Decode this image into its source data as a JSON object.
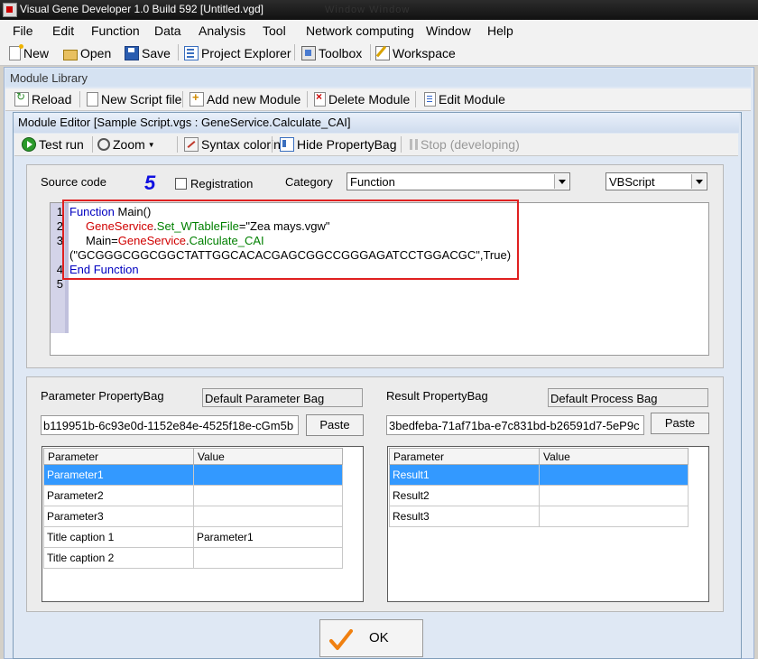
{
  "window": {
    "title": "Visual Gene Developer 1.0 Build 592    [Untitled.vgd]",
    "ghost_text": "Window     Window"
  },
  "menu": [
    "File",
    "Edit",
    "Function",
    "Data",
    "Analysis",
    "Tool",
    "Network computing",
    "Window",
    "Help"
  ],
  "toolbar": {
    "new": "New",
    "open": "Open",
    "save": "Save",
    "project_explorer": "Project Explorer",
    "toolbox": "Toolbox",
    "workspace": "Workspace"
  },
  "module_library": {
    "title": "Module Library",
    "toolbar": {
      "reload": "Reload",
      "new_script": "New Script file",
      "add_module": "Add new Module",
      "delete_module": "Delete Module",
      "edit_module": "Edit Module"
    }
  },
  "module_editor": {
    "title": "Module Editor    [Sample Script.vgs : GeneService.Calculate_CAI]",
    "toolbar": {
      "test_run": "Test run",
      "zoom": "Zoom",
      "syntax": "Syntax coloring",
      "hide_bag": "Hide PropertyBag",
      "stop": "Stop (developing)"
    },
    "source_code_label": "Source code",
    "step_number": "5",
    "registration_label": "Registration",
    "registration_checked": false,
    "category_label": "Category",
    "category_value": "Function",
    "language_value": "VBScript",
    "line_numbers": [
      "1",
      "2",
      "3",
      "4",
      "5"
    ],
    "code": {
      "l1_kw": "Function",
      "l1_rest": " Main()",
      "l2_obj": "GeneService",
      "l2_dot": ".",
      "l2_meth": "Set_WTableFile",
      "l2_rest": "=\"Zea mays.vgw\"",
      "l3_pre": "Main=",
      "l3_obj": "GeneService",
      "l3_dot": ".",
      "l3_meth": "Calculate_CAI",
      "l3_cont": "(\"GCGGGCGGCGGCTATTGGCACACGAGCGGCCGGGAGATCCTGGACGC\",True)",
      "l4_kw": "End Function"
    },
    "parameter_bag": {
      "label": "Parameter PropertyBag",
      "name": "Default Parameter Bag",
      "id": "b119951b-6c93e0d-1152e84e-4525f18e-cGm5b",
      "paste": "Paste",
      "columns": [
        "Parameter",
        "Value"
      ],
      "rows": [
        [
          "Parameter1",
          ""
        ],
        [
          "Parameter2",
          ""
        ],
        [
          "Parameter3",
          ""
        ],
        [
          "Title caption 1",
          "Parameter1"
        ],
        [
          "Title caption 2",
          ""
        ]
      ]
    },
    "result_bag": {
      "label": "Result PropertyBag",
      "name": "Default Process Bag",
      "id": "3bedfeba-71af71ba-e7c831bd-b26591d7-5eP9c",
      "paste": "Paste",
      "columns": [
        "Parameter",
        "Value"
      ],
      "rows": [
        [
          "Result1",
          ""
        ],
        [
          "Result2",
          ""
        ],
        [
          "Result3",
          ""
        ]
      ]
    },
    "ok_label": "OK"
  },
  "colors": {
    "keyword": "#0000c0",
    "object": "#d00000",
    "method": "#008000",
    "selection": "#3399ff",
    "highlight_box": "#e02020",
    "step_number": "#1010e0"
  }
}
